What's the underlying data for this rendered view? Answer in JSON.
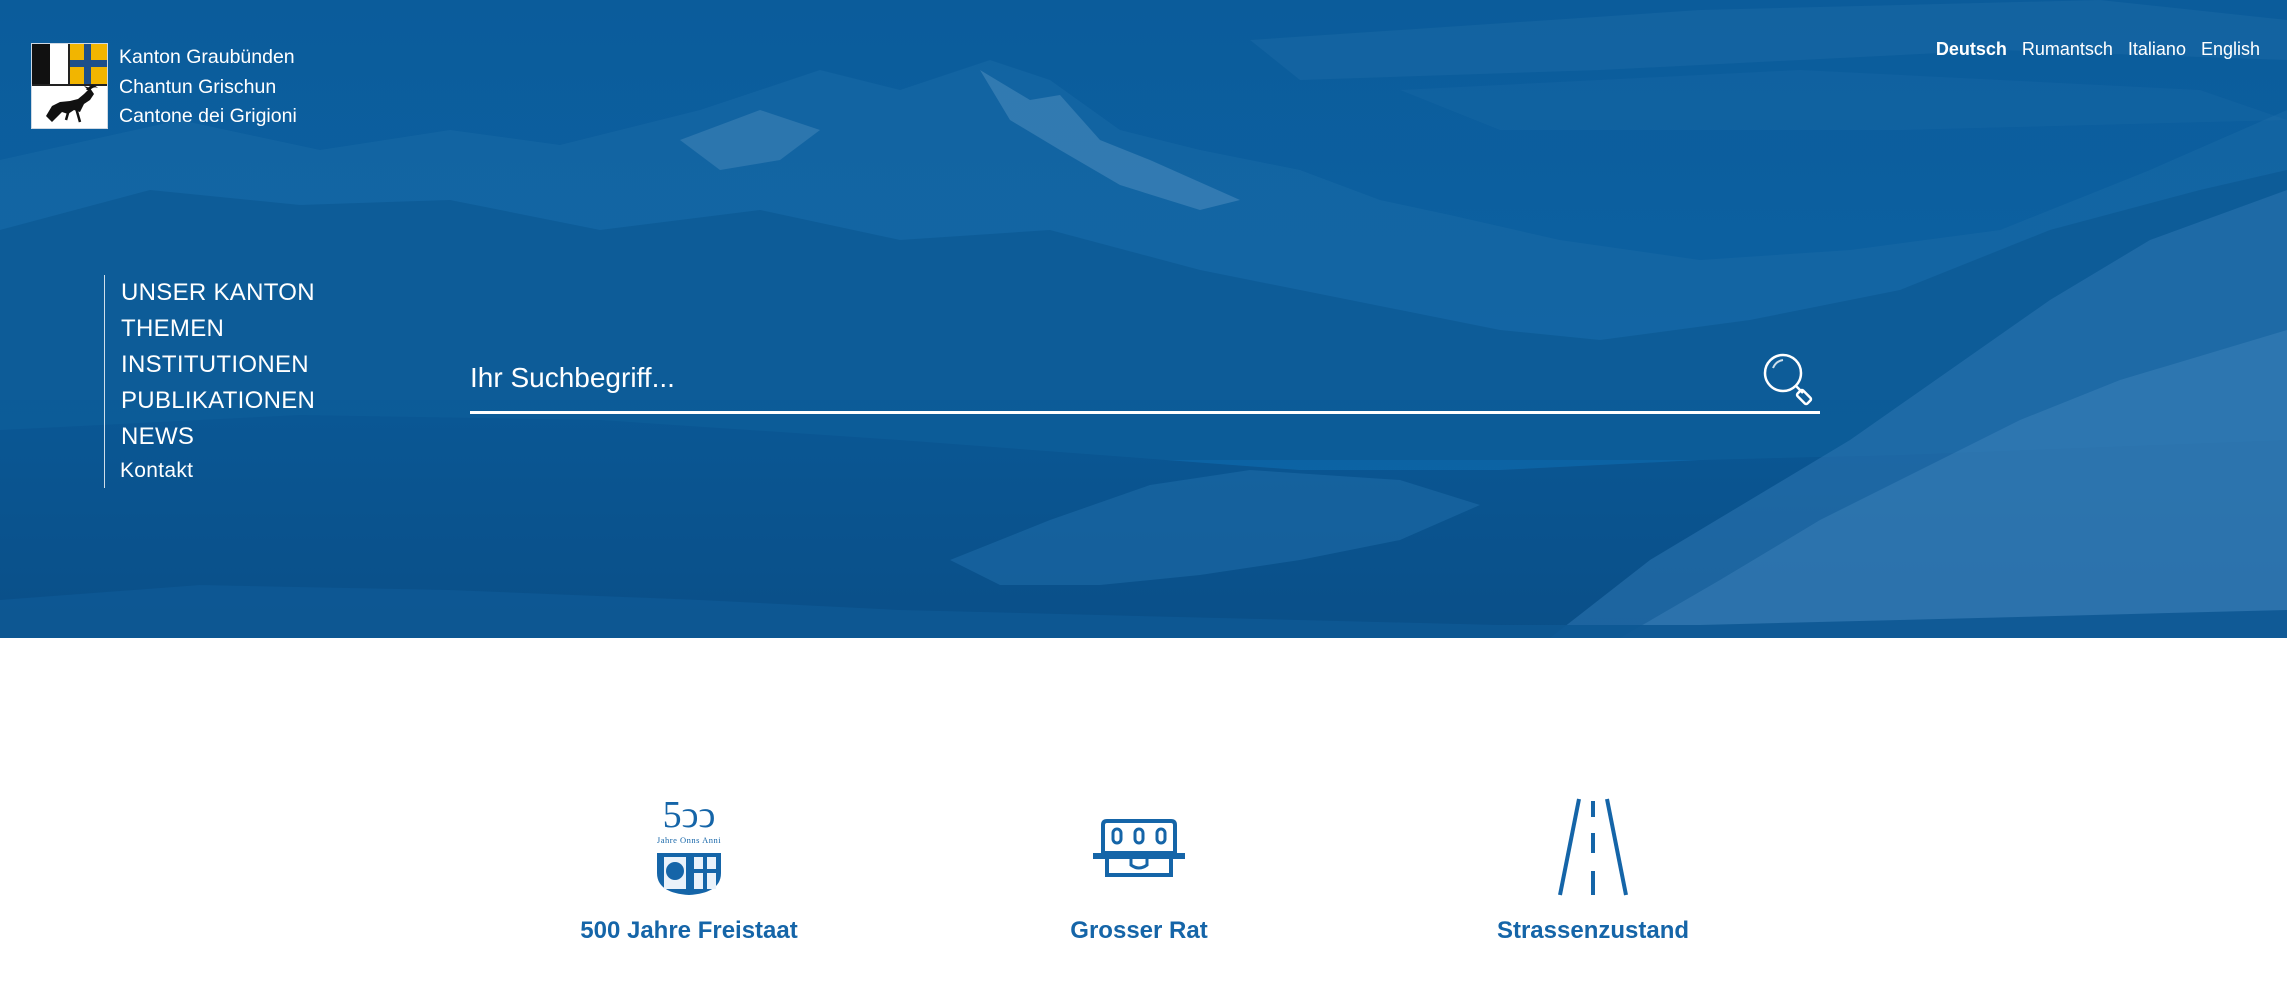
{
  "header": {
    "canton_names": [
      "Kanton Graubünden",
      "Chantun Grischun",
      "Cantone dei Grigioni"
    ]
  },
  "languages": [
    {
      "label": "Deutsch",
      "active": true
    },
    {
      "label": "Rumantsch",
      "active": false
    },
    {
      "label": "Italiano",
      "active": false
    },
    {
      "label": "English",
      "active": false
    }
  ],
  "nav": {
    "items": [
      "UNSER KANTON",
      "THEMEN",
      "INSTITUTIONEN",
      "PUBLIKATIONEN",
      "NEWS",
      "Kontakt"
    ]
  },
  "search": {
    "placeholder": "Ihr Suchbegriff...",
    "icon": "search-icon"
  },
  "tiles": [
    {
      "label": "500 Jahre Freistaat",
      "icon": "anniversary-500-icon",
      "icon_text": "Jahre Onns Anni"
    },
    {
      "label": "Grosser Rat",
      "icon": "parliament-building-icon"
    },
    {
      "label": "Strassenzustand",
      "icon": "road-icon"
    }
  ],
  "colors": {
    "hero_blue": "#0a5a98",
    "link_blue": "#1565a8",
    "flag_gold": "#f2b500"
  }
}
